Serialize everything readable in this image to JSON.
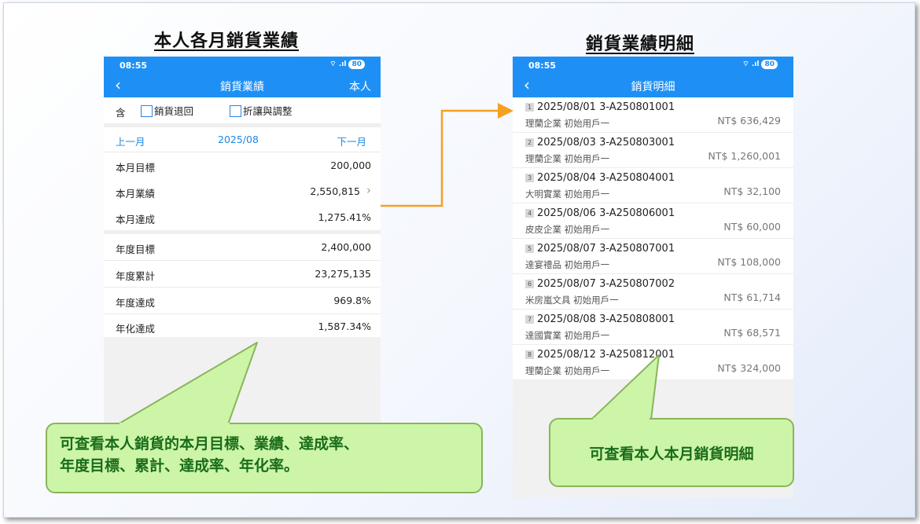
{
  "left_title": "本人各月銷貨業績",
  "right_title": "銷貨業績明細",
  "left_phone": {
    "status_time": "08:55",
    "status_icons": "⌔ .ıl",
    "battery": "80",
    "nav_title": "銷貨業績",
    "nav_right": "本人",
    "include_label": "含",
    "option_returns": "銷貨退回",
    "option_discounts": "折讓與調整",
    "prev_month": "上一月",
    "current_month": "2025/08",
    "next_month": "下一月",
    "monthly": [
      {
        "label": "本月目標",
        "value": "200,000"
      },
      {
        "label": "本月業績",
        "value": "2,550,815"
      },
      {
        "label": "本月達成",
        "value": "1,275.41%"
      }
    ],
    "yearly": [
      {
        "label": "年度目標",
        "value": "2,400,000"
      },
      {
        "label": "年度累計",
        "value": "23,275,135"
      },
      {
        "label": "年度達成",
        "value": "969.8%"
      },
      {
        "label": "年化達成",
        "value": "1,587.34%"
      }
    ]
  },
  "right_phone": {
    "status_time": "08:55",
    "status_icons": "⌔ .ıl",
    "battery": "80",
    "nav_title": "銷貨明細",
    "items": [
      {
        "idx": "1",
        "date": "2025/08/01",
        "no": "3-A250801001",
        "customer": "理蘭企業 初始用戶一",
        "amount": "NT$ 636,429"
      },
      {
        "idx": "2",
        "date": "2025/08/03",
        "no": "3-A250803001",
        "customer": "理蘭企業 初始用戶一",
        "amount": "NT$ 1,260,001"
      },
      {
        "idx": "3",
        "date": "2025/08/04",
        "no": "3-A250804001",
        "customer": "大明實業 初始用戶一",
        "amount": "NT$ 32,100"
      },
      {
        "idx": "4",
        "date": "2025/08/06",
        "no": "3-A250806001",
        "customer": "皮皮企業 初始用戶一",
        "amount": "NT$ 60,000"
      },
      {
        "idx": "5",
        "date": "2025/08/07",
        "no": "3-A250807001",
        "customer": "達宴禮品 初始用戶一",
        "amount": "NT$ 108,000"
      },
      {
        "idx": "6",
        "date": "2025/08/07",
        "no": "3-A250807002",
        "customer": "米房嵐文具 初始用戶一",
        "amount": "NT$ 61,714"
      },
      {
        "idx": "7",
        "date": "2025/08/08",
        "no": "3-A250808001",
        "customer": "達國實業 初始用戶一",
        "amount": "NT$ 68,571"
      },
      {
        "idx": "8",
        "date": "2025/08/12",
        "no": "3-A250812001",
        "customer": "理蘭企業 初始用戶一",
        "amount": "NT$ 324,000"
      }
    ]
  },
  "callout_left_line1": "可查看本人銷貨的本月目標、業績、達成率、",
  "callout_left_line2": "年度目標、累計、達成率、年化率。",
  "callout_right": "可查看本人本月銷貨明細",
  "colors": {
    "app_blue": "#1e90f5",
    "callout_fill": "#ccf5a8",
    "callout_text": "#1a6c1a",
    "arrow": "#f5a020"
  }
}
